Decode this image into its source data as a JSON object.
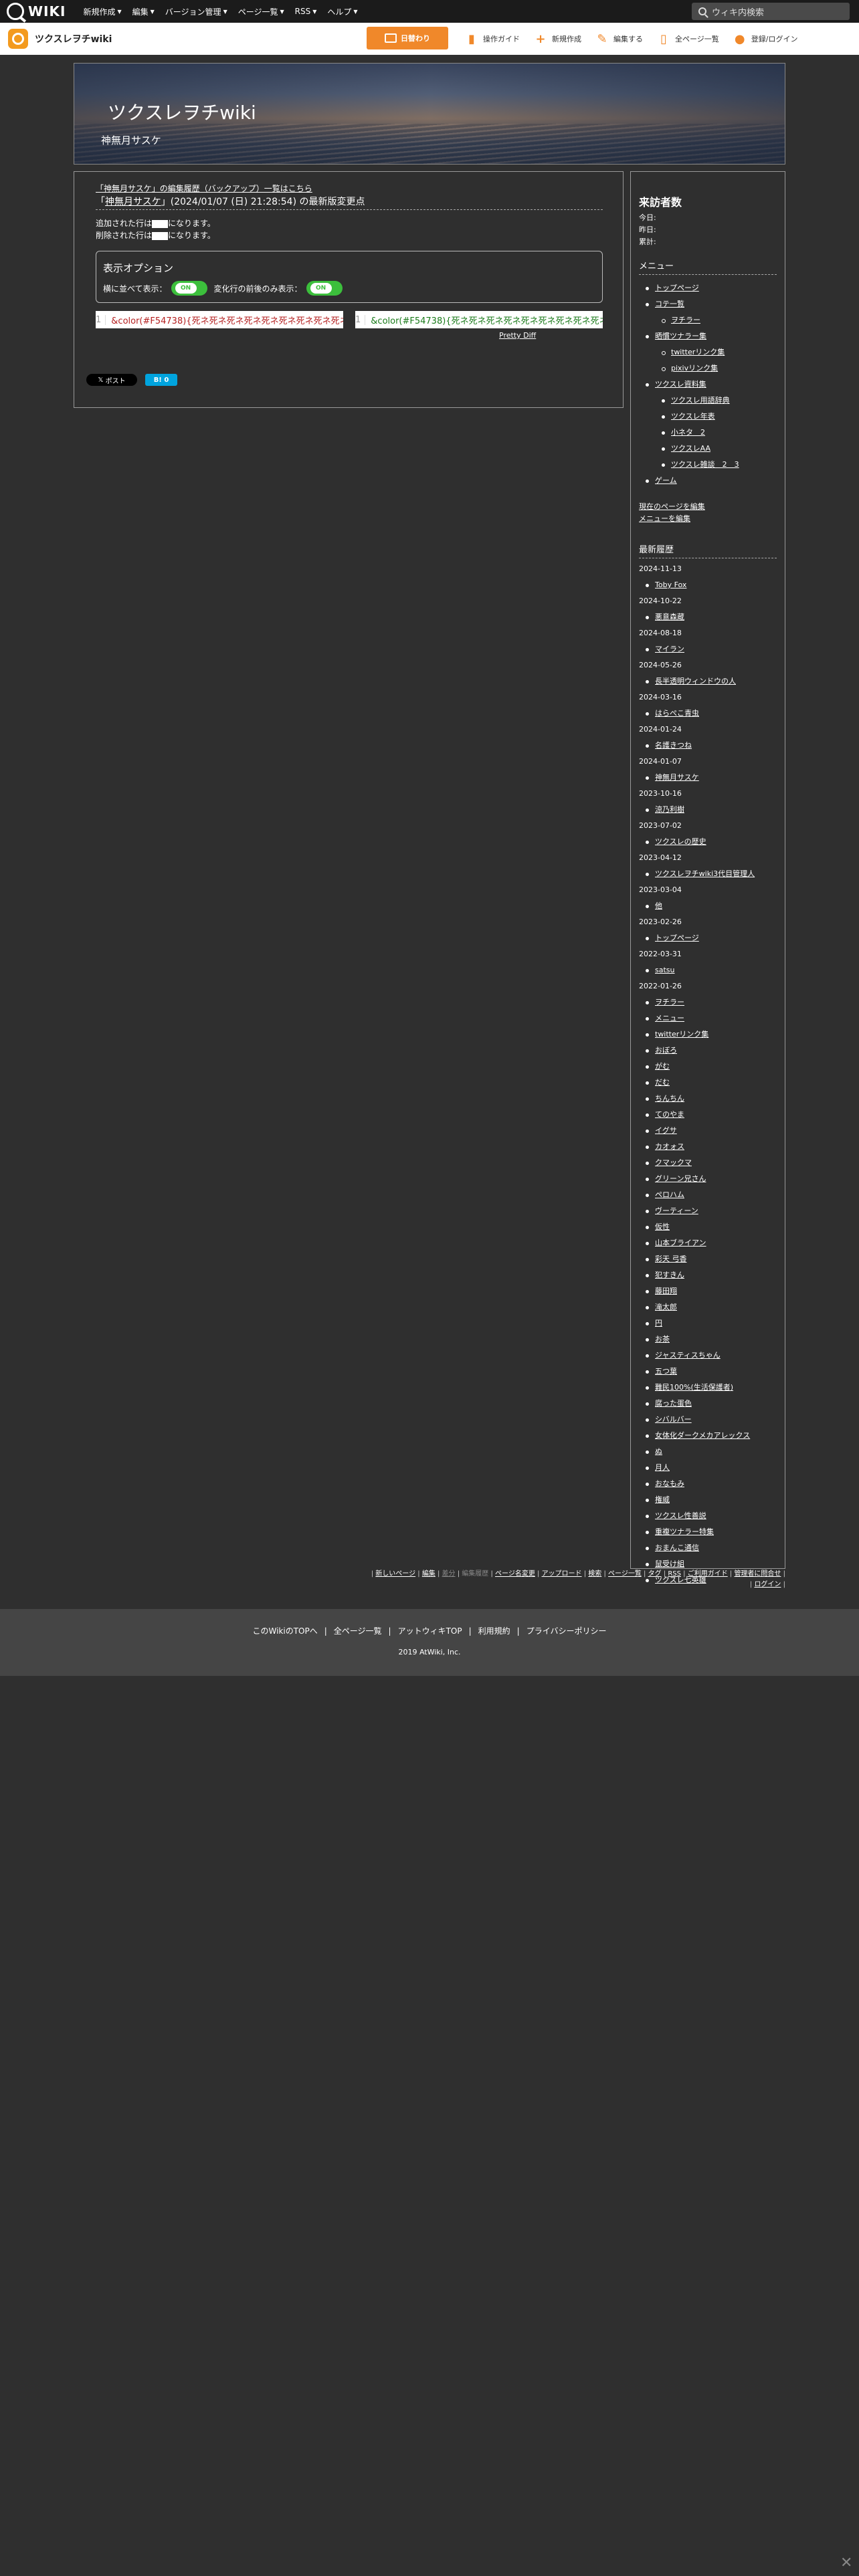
{
  "topbar": {
    "logo": "WIKI",
    "menu": [
      "新規作成",
      "編集",
      "バージョン管理",
      "ページ一覧",
      "RSS",
      "ヘルプ"
    ],
    "search_placeholder": "ウィキ内検索"
  },
  "sitebar": {
    "name": "ツクスレヲチwiki",
    "register": "日替わり",
    "tools": [
      {
        "icon": "book-icon",
        "label": "操作ガイド"
      },
      {
        "icon": "plus-icon",
        "label": "新規作成"
      },
      {
        "icon": "pencil-icon",
        "label": "編集する"
      },
      {
        "icon": "page-icon",
        "label": "全ページ一覧"
      },
      {
        "icon": "users-icon",
        "label": "登録/ログイン"
      }
    ]
  },
  "banner": {
    "title": "ツクスレヲチwiki",
    "subtitle": "神無月サスケ"
  },
  "main": {
    "history_link": "「神無月サスケ」の編集履歴（バックアップ）一覧はこちら",
    "page_link": "神無月サスケ",
    "title_rest": "(2024/01/07 (日) 21:28:54) の最新版変更点",
    "added": "追加された行は",
    "added2": "になります。",
    "deleted": "削除された行は",
    "deleted2": "になります。",
    "options_title": "表示オプション",
    "opt1": "横に並べて表示：",
    "opt2": "変化行の前後のみ表示：",
    "on": "ON",
    "diff_line": "1",
    "diff_text": "&color(#F54738){死ネ死ネ死ネ死ネ死ネ死ネ死ネ死ネ死ネ死ネ",
    "pretty": "Pretty Diff",
    "post": "ポスト",
    "hatena": "B! 0"
  },
  "side": {
    "visitors_title": "来訪者数",
    "today": "今日:",
    "yesterday": "昨日:",
    "total": "累計:",
    "menu_title": "メニュー",
    "menu": [
      {
        "t": "トップページ",
        "c": ""
      },
      {
        "t": "コテ一覧",
        "c": ""
      },
      {
        "t": "ヲチラー",
        "c": "l2"
      },
      {
        "t": "晒慣ツナラー集",
        "c": ""
      },
      {
        "t": "twitterリンク集",
        "c": "l2"
      },
      {
        "t": "pixivリンク集",
        "c": "l2"
      },
      {
        "t": "ツクスレ資料集",
        "c": ""
      },
      {
        "t": "ツクスレ用語辞典",
        "c": "l2b"
      },
      {
        "t": "ツクスレ年表",
        "c": "l2b"
      },
      {
        "t": "小ネタ　2",
        "c": "l2b"
      },
      {
        "t": "ツクスレAA",
        "c": "l2b"
      },
      {
        "t": "ツクスレ雑談　2　3",
        "c": "l2b"
      },
      {
        "t": "ゲーム",
        "c": ""
      }
    ],
    "edit_page": "現在のページを編集",
    "edit_menu": "メニューを編集",
    "recent_title": "最新履歴",
    "recent": [
      {
        "d": "2024-11-13",
        "items": [
          "Toby Fox"
        ]
      },
      {
        "d": "2024-10-22",
        "items": [
          "悪意森蔵"
        ]
      },
      {
        "d": "2024-08-18",
        "items": [
          "マイラン"
        ]
      },
      {
        "d": "2024-05-26",
        "items": [
          "長半透明ウィンドウの人"
        ]
      },
      {
        "d": "2024-03-16",
        "items": [
          "はらぺこ青虫"
        ]
      },
      {
        "d": "2024-01-24",
        "items": [
          "名護きつね"
        ]
      },
      {
        "d": "2024-01-07",
        "items": [
          "神無月サスケ"
        ]
      },
      {
        "d": "2023-10-16",
        "items": [
          "涼乃利樹"
        ]
      },
      {
        "d": "2023-07-02",
        "items": [
          "ツクスレの歴史"
        ]
      },
      {
        "d": "2023-04-12",
        "items": [
          "ツクスレヲチwiki3代目管理人"
        ]
      },
      {
        "d": "2023-03-04",
        "items": [
          "他"
        ]
      },
      {
        "d": "2023-02-26",
        "items": [
          "トップページ"
        ]
      },
      {
        "d": "2022-03-31",
        "items": [
          "satsu"
        ]
      },
      {
        "d": "2022-01-26",
        "items": [
          "ヲチラー",
          "メニュー",
          "twitterリンク集",
          "おぼろ",
          "がむ",
          "だむ",
          "ちんちん",
          "てのやま",
          "イグサ",
          "カオォス",
          "クマックマ",
          "グリーン兄さん",
          "ペロハム",
          "ヴーティーン",
          "仮性",
          "山本ブライアン",
          "彩天 弓香",
          "犯すきん",
          "藤田翔",
          "滝太郎",
          "円",
          "お茶",
          "ジャスティスちゃん",
          "五つ葉",
          "難民100%(生活保護者)",
          "腐った蛋色",
          "シバルバー",
          "女体化ダークメカアレックス",
          "ぬ",
          "月人",
          "おなもみ",
          "権威",
          "ツクスレ性善説",
          "重複ツナラー特集",
          "おまんこ通信",
          "鼠受け組",
          "ツクスレ七英雄"
        ]
      }
    ]
  },
  "flinks": {
    "row1": [
      "新しいページ",
      "編集",
      "差分",
      "編集履歴",
      "ページ名変更",
      "アップロード",
      "検索",
      "ページ一覧",
      "タグ",
      "RSS",
      "ご利用ガイド",
      "管理者に問合せ"
    ],
    "login": "ログイン"
  },
  "foot": {
    "links": [
      "このWikiのTOPへ",
      "全ページ一覧",
      "アットウィキTOP",
      "利用規約",
      "プライバシーポリシー"
    ],
    "copy": "2019 AtWiki, Inc."
  }
}
